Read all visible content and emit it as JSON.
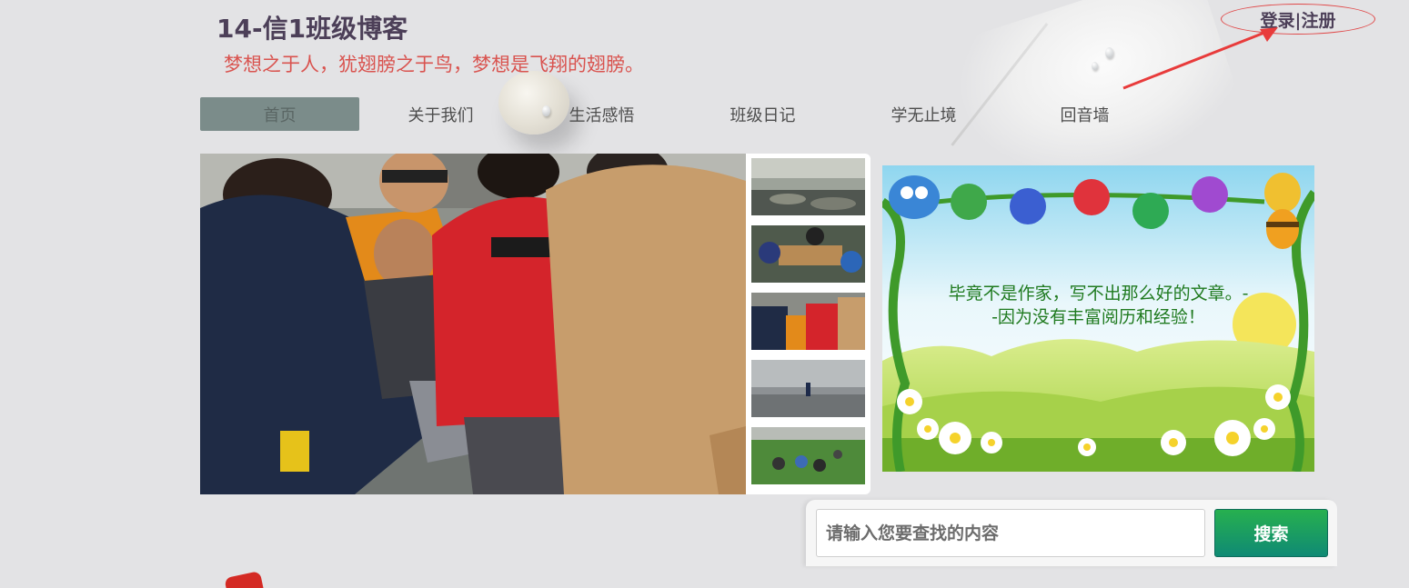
{
  "header": {
    "title": "14-信1班级博客",
    "motto": "梦想之于人，犹翅膀之于鸟，梦想是飞翔的翅膀。",
    "login_link": "登录|注册"
  },
  "nav": {
    "items": [
      {
        "label": "首页",
        "active": true
      },
      {
        "label": "关于我们",
        "active": false
      },
      {
        "label": "生活感悟",
        "active": false
      },
      {
        "label": "班级日记",
        "active": false
      },
      {
        "label": "学无止境",
        "active": false
      },
      {
        "label": "回音墙",
        "active": false
      }
    ]
  },
  "banner": {
    "line1": "毕竟不是作家，写不出那么好的文章。-",
    "line2": "-因为没有丰富阅历和经验！"
  },
  "search": {
    "placeholder": "请输入您要查找的内容",
    "button_label": "搜索"
  },
  "colors": {
    "title": "#4c3f58",
    "motto": "#d9534f",
    "nav_active": "#7b8c8a",
    "search_button": "#1a9a5f",
    "annotation_red": "#e04848"
  }
}
